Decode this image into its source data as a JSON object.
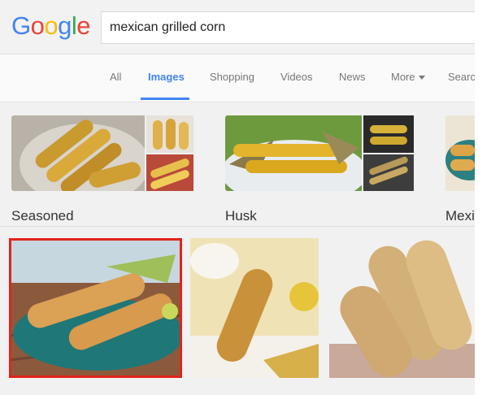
{
  "search": {
    "query": "mexican grilled corn"
  },
  "logo": {
    "letters": [
      "G",
      "o",
      "o",
      "g",
      "l",
      "e"
    ]
  },
  "tabs": [
    {
      "label": "All"
    },
    {
      "label": "Images"
    },
    {
      "label": "Shopping"
    },
    {
      "label": "Videos"
    },
    {
      "label": "News"
    },
    {
      "label": "More"
    },
    {
      "label": "Searc"
    }
  ],
  "related": [
    {
      "label": "Seasoned"
    },
    {
      "label": "Husk"
    },
    {
      "label": "Mexi"
    }
  ],
  "colors": {
    "accent": "#4285f4",
    "selection": "#e2231a"
  }
}
